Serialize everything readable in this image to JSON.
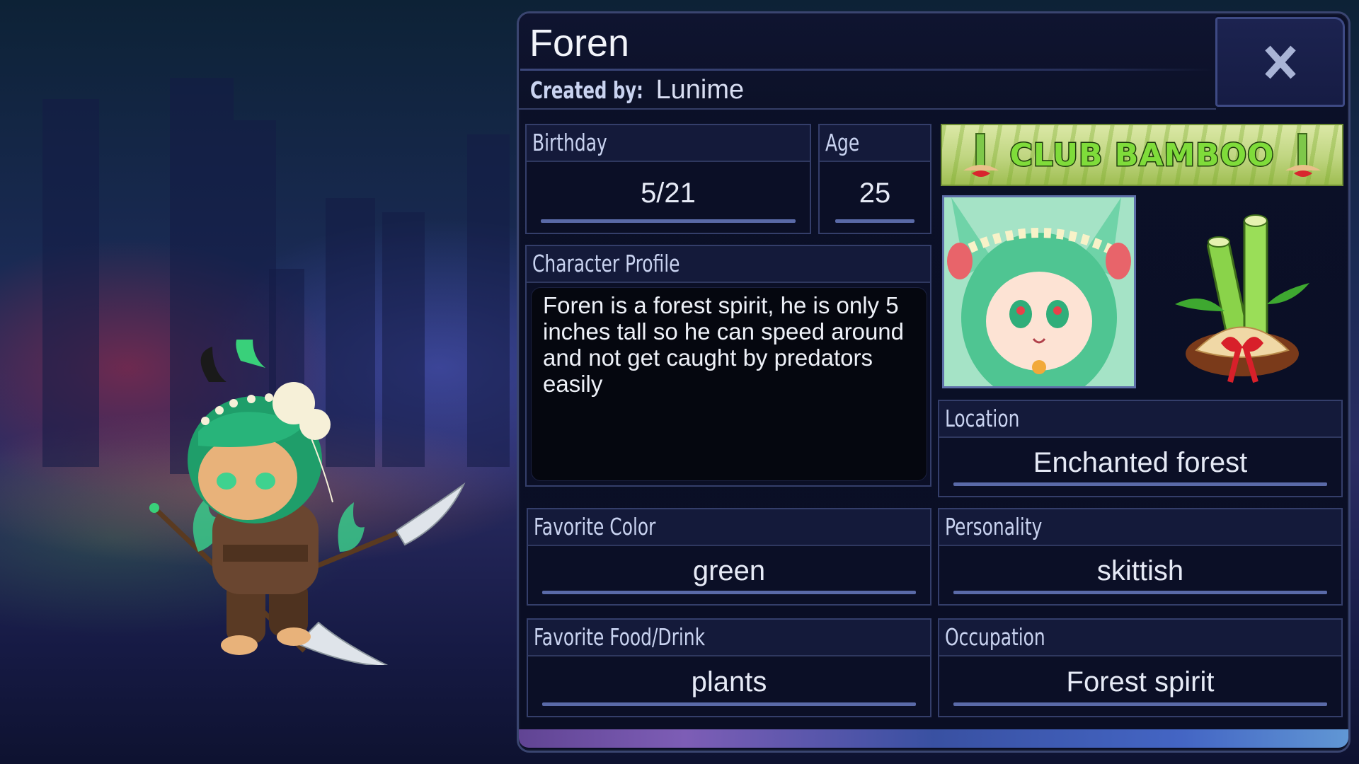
{
  "character": {
    "name": "Foren",
    "created_by_label": "Created by:",
    "created_by": "Lunime"
  },
  "close_button": {
    "label": "X",
    "icon": "close-icon"
  },
  "fields": {
    "birthday": {
      "label": "Birthday",
      "value": "5/21"
    },
    "age": {
      "label": "Age",
      "value": "25"
    },
    "profile": {
      "label": "Character Profile",
      "text": "Foren is a forest spirit, he is only 5 inches tall so he can speed around and not get caught by predators easily"
    },
    "location": {
      "label": "Location",
      "value": "Enchanted forest"
    },
    "favorite_color": {
      "label": "Favorite Color",
      "value": "green"
    },
    "personality": {
      "label": "Personality",
      "value": "skittish"
    },
    "favorite_food": {
      "label": "Favorite Food/Drink",
      "value": "plants"
    },
    "occupation": {
      "label": "Occupation",
      "value": "Forest spirit"
    }
  },
  "club": {
    "name": "CLUB BAMBOO",
    "portrait_icon": "club-mascot-portrait",
    "emblem_icon": "bamboo-emblem-icon"
  },
  "colors": {
    "panel_bg": "#0b0f26",
    "label_text": "#c9d3f0",
    "accent_line": "#5a6aa8",
    "club_text": "#7fdc3a"
  }
}
